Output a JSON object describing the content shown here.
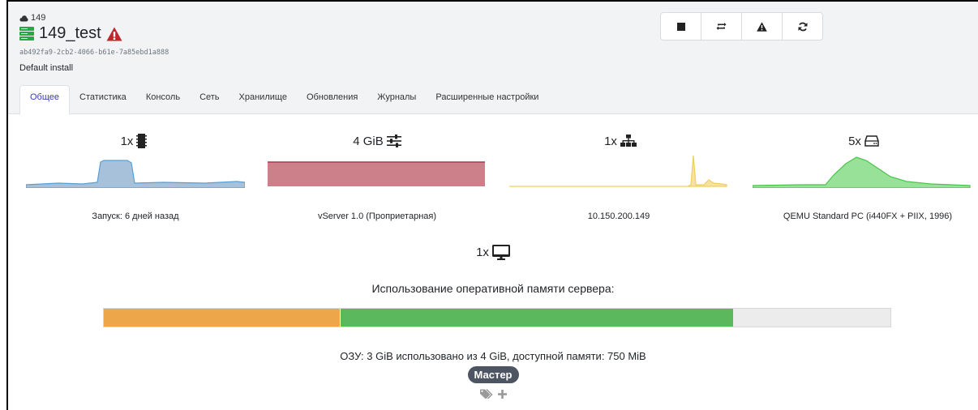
{
  "header": {
    "pool_label": "149",
    "vm_name": "149_test",
    "uuid": "ab492fa9-2cb2-4066-b61e-7a85ebd1a888",
    "description": "Default install",
    "warning_color": "#c0262b"
  },
  "actions": [
    {
      "name": "stop-icon"
    },
    {
      "name": "restart-icon"
    },
    {
      "name": "force-warning-icon"
    },
    {
      "name": "refresh-icon"
    }
  ],
  "tabs": [
    "Общее",
    "Статистика",
    "Консоль",
    "Сеть",
    "Хранилище",
    "Обновления",
    "Журналы",
    "Расширенные настройки"
  ],
  "active_tab": 0,
  "stats": {
    "cpu": {
      "count": "1x",
      "icon": "cpu-chip-icon",
      "caption": "Запуск: 6 дней назад",
      "color": "#5a9fd4"
    },
    "memory": {
      "count": "4 GiB",
      "icon": "sliders-icon",
      "caption": "vServer 1.0 (Проприетарная)",
      "color": "#c36a76"
    },
    "network": {
      "count": "1x",
      "icon": "network-icon",
      "caption": "10.150.200.149",
      "color": "#f0cf5a"
    },
    "disk": {
      "count": "5x",
      "icon": "hdd-icon",
      "caption": "QEMU Standard PC (i440FX + PIIX, 1996)",
      "color": "#5fd35f"
    }
  },
  "gpu": {
    "count": "1x",
    "icon": "monitor-icon"
  },
  "memory_usage": {
    "title": "Использование оперативной памяти сервера:",
    "used_fraction": 0.3,
    "available_fraction": 0.5,
    "summary": "ОЗУ: 3 GiB использовано из 4 GiB, доступной памяти: 750 MiB"
  },
  "badge": "Мастер",
  "tags_icons": [
    "tags-icon",
    "plus-icon"
  ]
}
